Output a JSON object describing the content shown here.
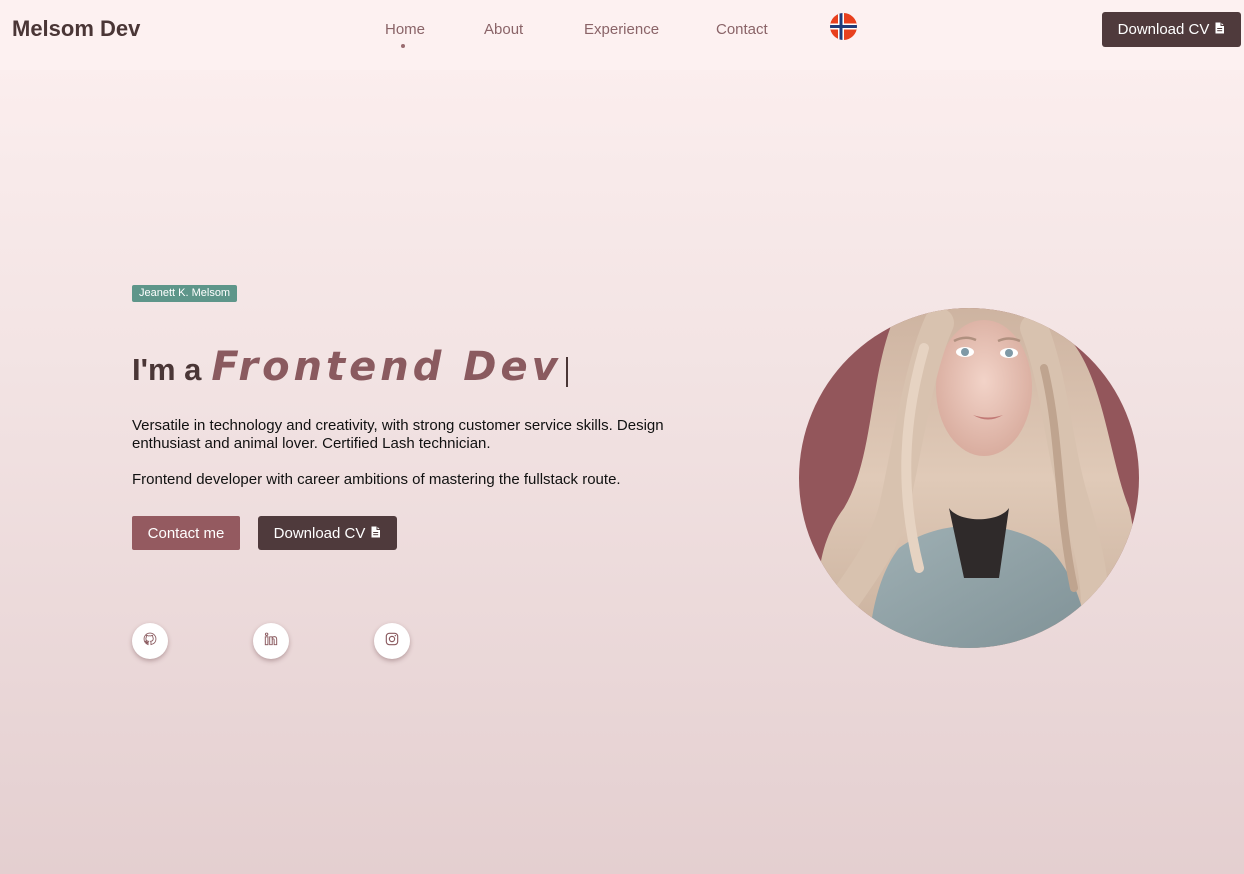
{
  "nav": {
    "logo": "Melsom Dev",
    "links": [
      "Home",
      "About",
      "Experience",
      "Contact"
    ],
    "cv_button": "Download CV"
  },
  "hero": {
    "badge": "Jeanett K. Melsom",
    "headline_prefix": "I'm a",
    "headline_role": "Frontend Dev",
    "description_1": "Versatile in technology and creativity, with strong customer service skills. Design enthusiast and animal lover. Certified Lash technician.",
    "description_2": "Frontend developer with career ambitions of mastering the fullstack route.",
    "contact_button": "Contact me",
    "cv_button": "Download CV"
  },
  "social": [
    "github-icon",
    "linkedin-icon",
    "instagram-icon"
  ],
  "colors": {
    "dark": "#4f3a3c",
    "accent": "#945a60",
    "badge": "#5e968a",
    "background": "#f3e4e4"
  }
}
